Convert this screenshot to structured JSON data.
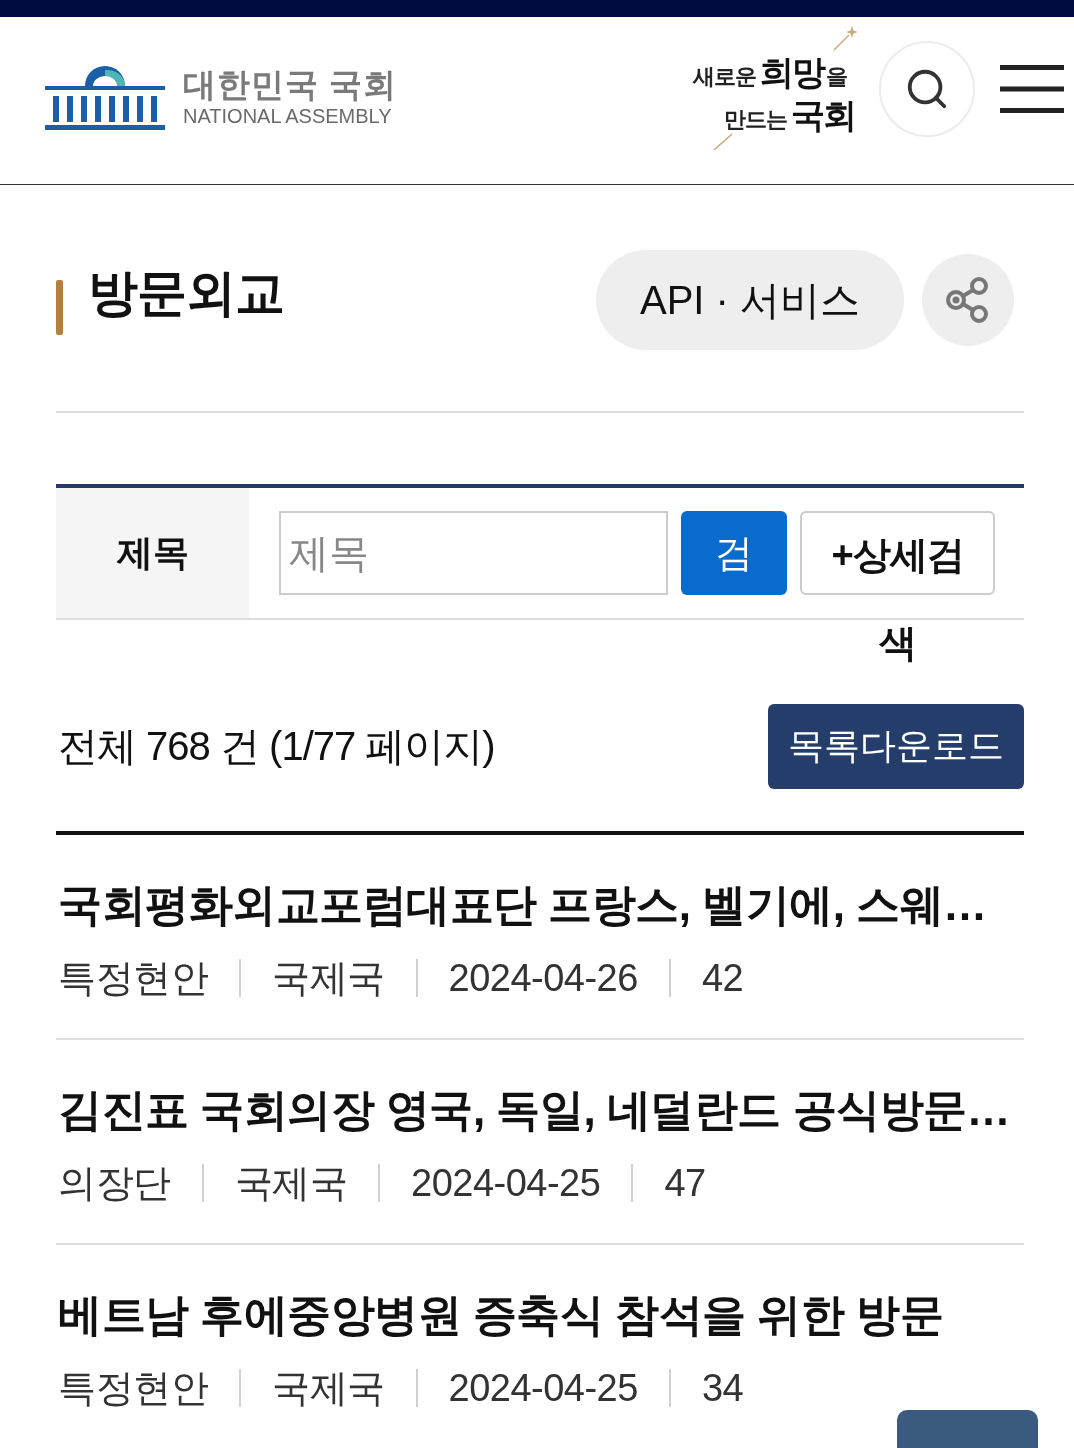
{
  "header": {
    "logo": {
      "name_ko": "대한민국 국회",
      "name_en": "NATIONAL ASSEMBLY"
    },
    "slogan": {
      "line_1": "새로운**희망**을",
      "line_2": "만드는**국회**"
    }
  },
  "page_title": "방문외교",
  "api_button": "API · 서비스",
  "search": {
    "label": "제목",
    "placeholder": "제목",
    "search_button": "검",
    "detail_button": "+상세검색"
  },
  "summary": {
    "text": "전체 768 건 (1/77 페이지)",
    "download_button": "목록다운로드"
  },
  "items": [
    {
      "title": "국회평화외교포럼대표단 프랑스, 벨기에, 스웨…",
      "meta": [
        "특정현안",
        "국제국",
        "2024-04-26",
        "42"
      ]
    },
    {
      "title": "김진표 국회의장 영국, 독일, 네덜란드 공식방문…",
      "meta": [
        "의장단",
        "국제국",
        "2024-04-25",
        "47"
      ]
    },
    {
      "title": "베트남 후에중앙병원 증축식 참석을 위한 방문",
      "meta": [
        "특정현안",
        "국제국",
        "2024-04-25",
        "34"
      ]
    }
  ]
}
